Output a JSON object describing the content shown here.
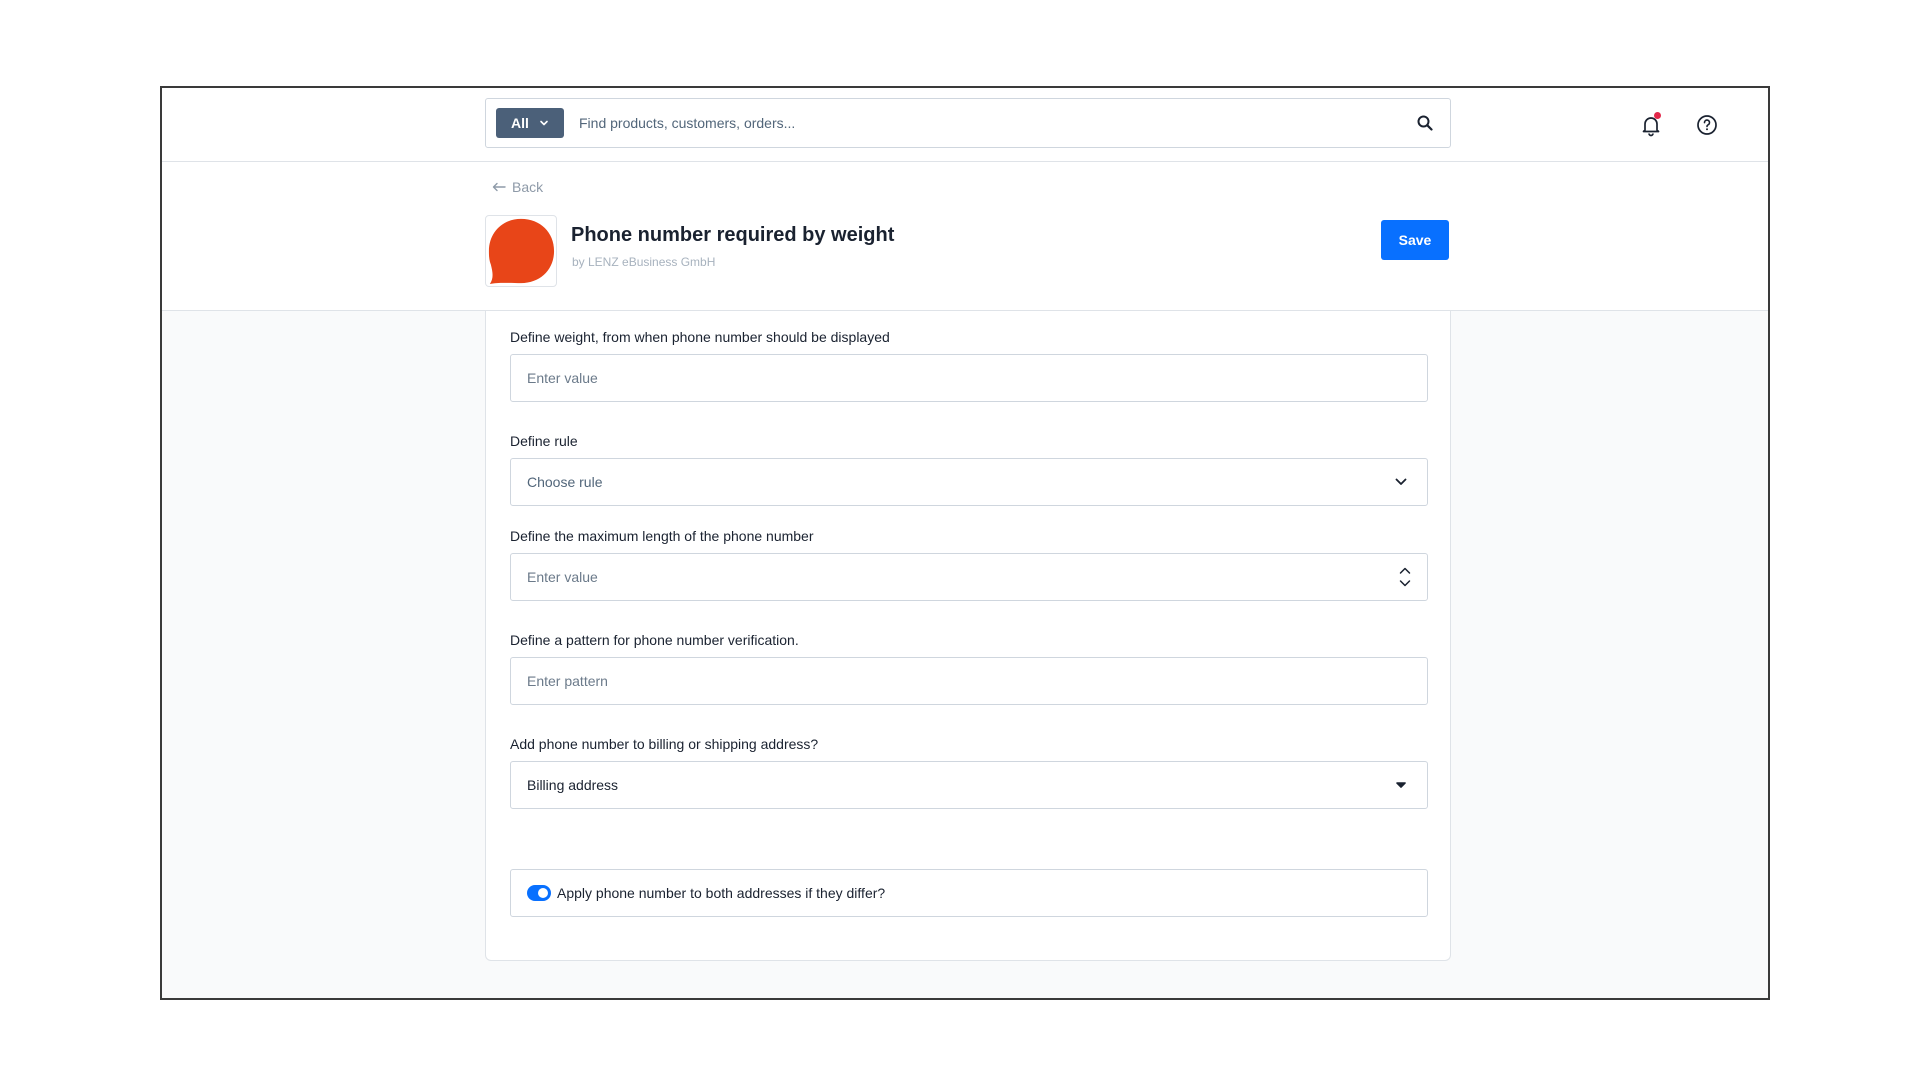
{
  "topbar": {
    "search_type": "All",
    "search_placeholder": "Find products, customers, orders..."
  },
  "header": {
    "back_label": "Back",
    "app_title": "Phone number required by weight",
    "app_vendor": "by LENZ eBusiness GmbH",
    "save_label": "Save",
    "logo_color": "#e84518"
  },
  "form": {
    "weight": {
      "label": "Define weight, from when phone number should be displayed",
      "placeholder": "Enter value"
    },
    "rule": {
      "label": "Define rule",
      "value": "Choose rule"
    },
    "max_length": {
      "label": "Define the maximum length of the phone number",
      "placeholder": "Enter value"
    },
    "pattern": {
      "label": "Define a pattern for phone number verification.",
      "placeholder": "Enter pattern"
    },
    "address": {
      "label": "Add phone number to billing or shipping address?",
      "value": "Billing address"
    },
    "apply_both": {
      "label": "Apply phone number to both addresses if they differ?",
      "enabled": true
    }
  },
  "colors": {
    "primary": "#0870ff",
    "search_type_bg": "#4b6079",
    "notification_dot": "#e3284a"
  }
}
